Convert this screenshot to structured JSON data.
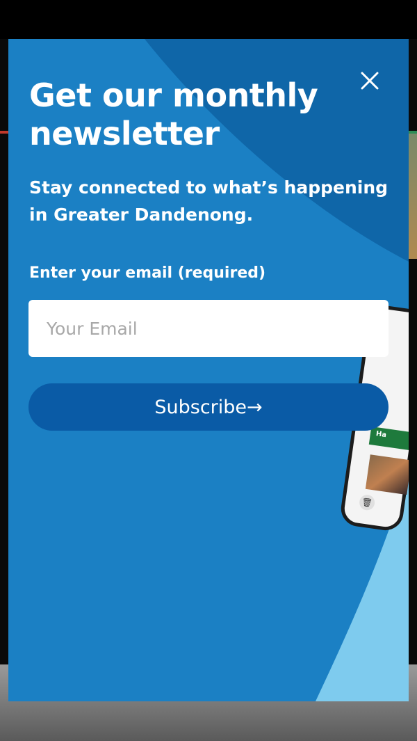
{
  "newsletter_modal": {
    "title": "Get our monthly newsletter",
    "subtitle": "Stay connected to what’s happening in Greater Dandenong.",
    "email_label": "Enter your email (required)",
    "email_placeholder": "Your Email",
    "email_value": "",
    "subscribe_label": "Subscribe→",
    "close_icon": "close-icon"
  },
  "phone_mockup": {
    "visible_text": "Ha"
  },
  "colors": {
    "modal_background": "#1b80c4",
    "modal_dark_arc": "#0f66a8",
    "modal_light_arc": "#7ecbee",
    "button_background": "#0a5ba6",
    "text": "#ffffff",
    "phone_accent": "#1e7a3c"
  }
}
